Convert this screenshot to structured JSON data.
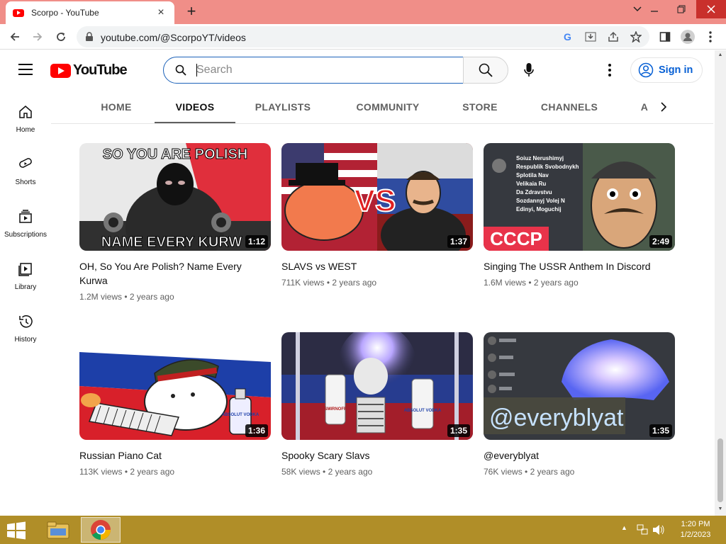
{
  "browser": {
    "tab_title": "Scorpo - YouTube",
    "url": "youtube.com/@ScorpoYT/videos",
    "tab_close": "×",
    "new_tab": "+"
  },
  "masthead": {
    "logo_text": "YouTube",
    "search_placeholder": "Search",
    "signin_label": "Sign in"
  },
  "guide": {
    "items": [
      {
        "label": "Home",
        "icon": "home-icon"
      },
      {
        "label": "Shorts",
        "icon": "shorts-icon"
      },
      {
        "label": "Subscriptions",
        "icon": "subscriptions-icon"
      },
      {
        "label": "Library",
        "icon": "library-icon"
      },
      {
        "label": "History",
        "icon": "history-icon"
      }
    ]
  },
  "channel_tabs": {
    "items": [
      "HOME",
      "VIDEOS",
      "PLAYLISTS",
      "COMMUNITY",
      "STORE",
      "CHANNELS",
      "A"
    ],
    "active": "VIDEOS"
  },
  "videos": [
    {
      "title": "OH, So You Are Polish? Name Every Kurwa",
      "views": "1.2M views",
      "age": "2 years ago",
      "duration": "1:12",
      "thumb_text_top": "SO YOU ARE POLISH",
      "thumb_text_bottom": "NAME EVERY KURW"
    },
    {
      "title": "SLAVS vs WEST",
      "views": "711K views",
      "age": "2 years ago",
      "duration": "1:37",
      "thumb_text": "VS"
    },
    {
      "title": "Singing The USSR Anthem In Discord",
      "views": "1.6M views",
      "age": "2 years ago",
      "duration": "2:49",
      "thumb_text": "CCCP",
      "thumb_lines": [
        "Soiuz Nerushimyj",
        "Respublik Svobodnykh",
        "Splotila Nav",
        "Velikaia Ru",
        "Da Zdravstvu",
        "Sozdannyj Volej N",
        "Edinyi, Moguchij"
      ]
    },
    {
      "title": "Russian Piano Cat",
      "views": "113K views",
      "age": "2 years ago",
      "duration": "1:36",
      "thumb_text": "ABSOLUT VODKA"
    },
    {
      "title": "Spooky Scary Slavs",
      "views": "58K views",
      "age": "2 years ago",
      "duration": "1:35",
      "thumb_text_left": "SMIRNOFF",
      "thumb_text_right": "ABSOLUT VODKA"
    },
    {
      "title": "@everyblyat",
      "views": "76K views",
      "age": "2 years ago",
      "duration": "1:35",
      "thumb_text": "@everyblyat"
    }
  ],
  "taskbar": {
    "time": "1:20 PM",
    "date": "1/2/2023"
  },
  "colors": {
    "titlebar": "#f08e88",
    "youtube_red": "#ff0000",
    "link_blue": "#065fd4",
    "taskbar": "#b08e28"
  }
}
